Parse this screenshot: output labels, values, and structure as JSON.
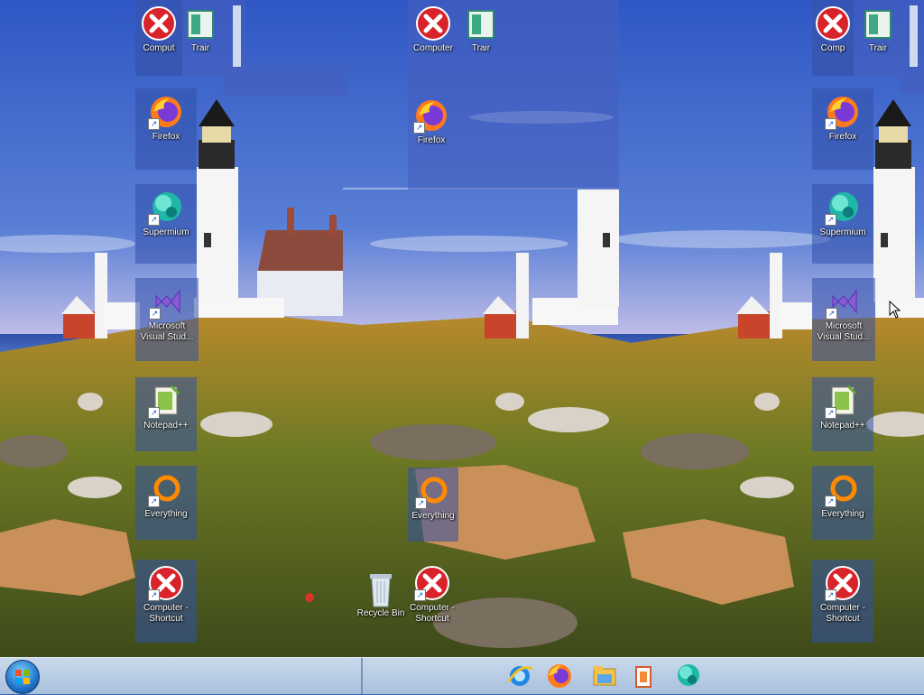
{
  "desktop": {
    "icons": {
      "computer_a": "Comput",
      "train_a": "Trair",
      "computer_b": "Computer",
      "train_b": "Trair",
      "computer_c": "Comp",
      "train_c": "Trair",
      "firefox_a": "Firefox",
      "firefox_b": "Firefox",
      "firefox_c": "Firefox",
      "supermium_a": "Supermium",
      "supermium_c": "Supermium",
      "vs_a": "Microsoft Visual Stud...",
      "vs_c": "Microsoft Visual Stud...",
      "notepad_a": "Notepad++",
      "notepad_c": "Notepad++",
      "everything_a": "Everything",
      "everything_b": "Everything",
      "everything_c": "Everything",
      "computer_shortcut_a": "Computer - Shortcut",
      "computer_shortcut_b": "Computer - Shortcut",
      "computer_shortcut_c": "Computer - Shortcut",
      "recycle_bin": "Recycle Bin"
    }
  },
  "taskbar": {
    "start_icon": "windows-start-orb",
    "pinned": [
      "internet-explorer-icon",
      "firefox-icon",
      "file-explorer-icon",
      "office-icon",
      "supermium-icon"
    ]
  },
  "colors": {
    "sky": "#3a5fc0",
    "taskbar": "#b8cde6",
    "selection": "#3250aa"
  }
}
